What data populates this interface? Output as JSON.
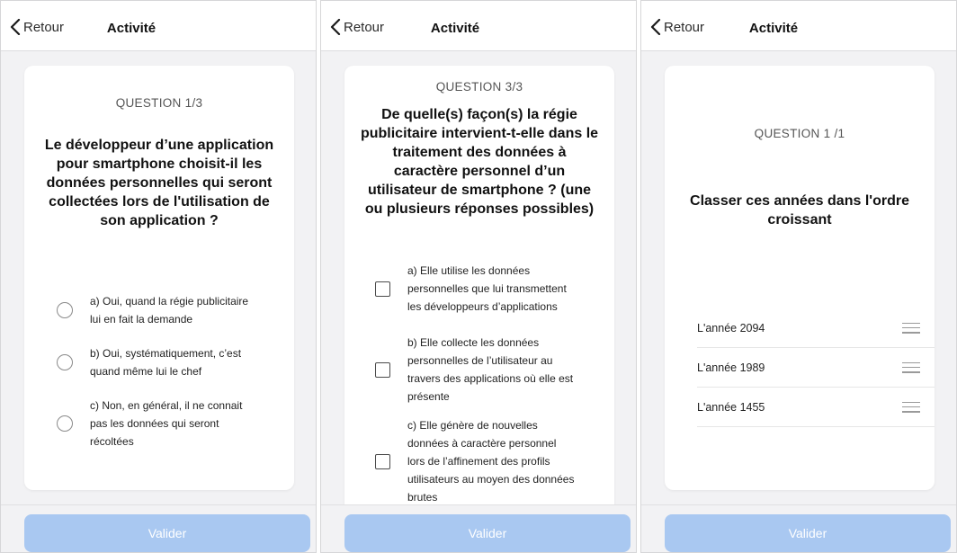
{
  "nav": {
    "back_label": "Retour",
    "title": "Activité"
  },
  "footer": {
    "validate_label": "Valider"
  },
  "colors": {
    "validate_button": "#a9c8f1",
    "background": "#f2f2f4"
  },
  "screen1": {
    "question_number": "QUESTION 1/3",
    "question_lines": [
      "Le développeur d’une application",
      "pour smartphone choisit-il les",
      "données personnelles qui seront",
      "collectées lors de l'utilisation de",
      "son application ?"
    ],
    "options": [
      {
        "lines": [
          "a) Oui, quand la régie publicitaire",
          "lui en fait la demande"
        ]
      },
      {
        "lines": [
          "b) Oui, systématiquement, c’est",
          "quand même lui le chef"
        ]
      },
      {
        "lines": [
          "c) Non, en général, il ne connait",
          "pas les données qui seront",
          "récoltées"
        ]
      }
    ]
  },
  "screen2": {
    "question_number": "QUESTION 3/3",
    "question_lines": [
      "De quelle(s) façon(s) la régie",
      "publicitaire intervient-t-elle dans le",
      "traitement des données à",
      "caractère personnel d’un",
      "utilisateur de smartphone ? (une",
      "ou plusieurs réponses possibles)"
    ],
    "options": [
      {
        "lines": [
          "a) Elle utilise les données",
          "personnelles que lui transmettent",
          "les développeurs d’applications"
        ]
      },
      {
        "lines": [
          "b) Elle collecte les données",
          "personnelles de l’utilisateur au",
          "travers des applications où elle est",
          "présente"
        ]
      },
      {
        "lines": [
          "c) Elle génère de nouvelles",
          "données à caractère personnel",
          "lors de l’affinement des profils",
          "utilisateurs au moyen des données",
          "brutes"
        ]
      }
    ]
  },
  "screen3": {
    "question_number": "QUESTION 1 /1",
    "question_lines": [
      "Classer ces années dans l'ordre",
      "croissant"
    ],
    "items": [
      {
        "label": "L'année 2094"
      },
      {
        "label": "L'année 1989"
      },
      {
        "label": "L'année 1455"
      }
    ]
  }
}
